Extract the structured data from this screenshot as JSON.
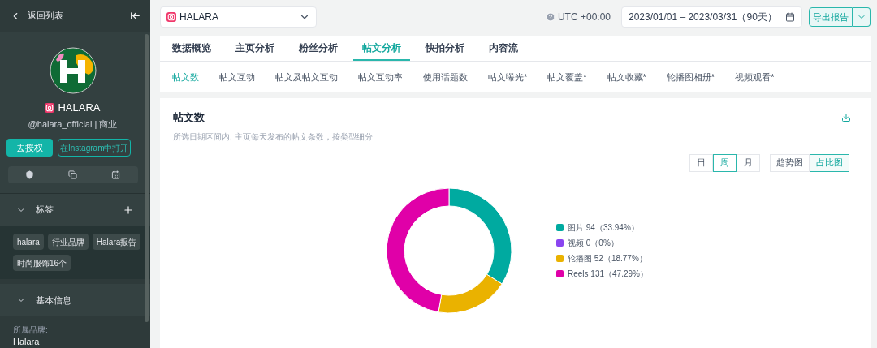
{
  "sidebar": {
    "back_label": "返回列表",
    "profile": {
      "name": "HALARA",
      "handle": "@halara_official | 商业"
    },
    "buttons": [
      {
        "label": "去授权",
        "kind": "primary"
      },
      {
        "label": "在Instagram中打开",
        "kind": "outline"
      }
    ],
    "tags_section": {
      "title": "标签",
      "expanded": true,
      "tags": [
        "halara",
        "行业品牌",
        "Halara报告",
        "时尚服饰16个"
      ]
    },
    "info_section": {
      "title": "基本信息",
      "expanded": true,
      "fields": [
        {
          "label": "所属品牌:",
          "value": "Halara"
        }
      ]
    }
  },
  "topbar": {
    "account": "HALARA",
    "timezone": "UTC +00:00",
    "date_range": "2023/01/01 – 2023/03/31（90天）",
    "export_label": "导出报告"
  },
  "tabs": [
    {
      "label": "数据概览",
      "selected": false
    },
    {
      "label": "主页分析",
      "selected": false
    },
    {
      "label": "粉丝分析",
      "selected": false
    },
    {
      "label": "帖文分析",
      "selected": true
    },
    {
      "label": "快拍分析",
      "selected": false
    },
    {
      "label": "内容流",
      "selected": false
    }
  ],
  "subtabs": [
    {
      "label": "帖文数",
      "selected": true
    },
    {
      "label": "帖文互动",
      "selected": false
    },
    {
      "label": "帖文及帖文互动",
      "selected": false
    },
    {
      "label": "帖文互动率",
      "selected": false
    },
    {
      "label": "使用话题数",
      "selected": false
    },
    {
      "label": "帖文曝光*",
      "selected": false
    },
    {
      "label": "帖文覆盖*",
      "selected": false
    },
    {
      "label": "帖文收藏*",
      "selected": false
    },
    {
      "label": "轮播图相册*",
      "selected": false
    },
    {
      "label": "视频观看*",
      "selected": false
    }
  ],
  "panel": {
    "title": "帖文数",
    "description": "所选日期区间内, 主页每天发布的帖文条数，按类型细分",
    "periods": [
      {
        "label": "日",
        "selected": false
      },
      {
        "label": "周",
        "selected": true
      },
      {
        "label": "月",
        "selected": false
      }
    ],
    "views": [
      {
        "label": "趋势图",
        "selected": false
      },
      {
        "label": "占比图",
        "selected": true
      }
    ],
    "legend": [
      {
        "label": "图片 94（33.94%）",
        "color": "#00aaa0"
      },
      {
        "label": "视频 0（0%）",
        "color": "#8a45f0"
      },
      {
        "label": "轮播图 52（18.77%）",
        "color": "#eab200"
      },
      {
        "label": "Reels 131（47.29%）",
        "color": "#e000a8"
      }
    ],
    "chart_data": {
      "type": "donut",
      "values": [
        33.94,
        0,
        18.77,
        47.29
      ]
    }
  }
}
